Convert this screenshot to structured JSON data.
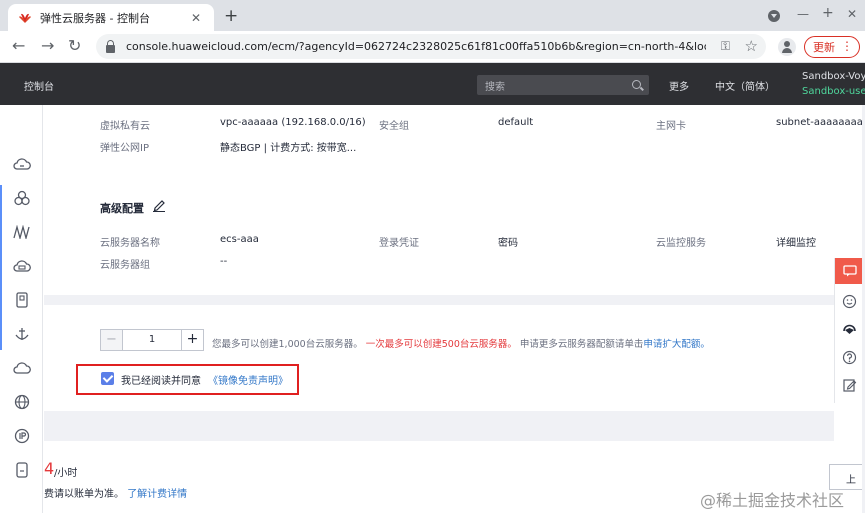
{
  "browser": {
    "tab_title": "弹性云服务器 - 控制台",
    "url": "console.huaweicloud.com/ecm/?agencyId=062724c2328025c61f81c00ffa510b6b&region=cn-north-4&loca…",
    "update_label": "更新"
  },
  "console": {
    "home_label": "控制台",
    "search_placeholder": "搜索",
    "more_label": "更多",
    "lang_label": "中文（简体）",
    "user_name": "Sandbox-Voy",
    "user_sub": "Sandbox-use"
  },
  "network": {
    "vpc_label": "虚拟私有云",
    "vpc_value": "vpc-aaaaaa (192.168.0.0/16)",
    "sg_label": "安全组",
    "sg_value": "default",
    "nic_label": "主网卡",
    "nic_value": "subnet-aaaaaaaaa",
    "eip_label": "弹性公网IP",
    "eip_value": "静态BGP | 计费方式: 按带宽..."
  },
  "advanced": {
    "title": "高级配置",
    "name_label": "云服务器名称",
    "name_value": "ecs-aaa",
    "cred_label": "登录凭证",
    "cred_value": "密码",
    "monitor_label": "云监控服务",
    "monitor_value": "详细监控",
    "group_label": "云服务器组",
    "group_value": "--"
  },
  "purchase": {
    "quantity": "1",
    "minus": "−",
    "plus": "+",
    "hint_1": "您最多可以创建1,000台云服务器。",
    "hint_2": "一次最多可以创建500台云服务器。",
    "hint_3": "申请更多云服务器配额请单击",
    "hint_link": "申请扩大配额。",
    "agree_text": "我已经阅读并同意",
    "agree_link": "《镜像免责声明》",
    "agree_checked": true
  },
  "price": {
    "amount": "4",
    "unit": "/小时",
    "note": "费请以账单为准。",
    "note_link": "了解计费详情",
    "prev_label": "上"
  },
  "watermark": "@稀土掘金技术社区",
  "colors": {
    "accent_red": "#e4393c",
    "link_blue": "#3277c8",
    "header_bg": "#2e2f33",
    "checkbox_blue": "#5b7fe8"
  }
}
